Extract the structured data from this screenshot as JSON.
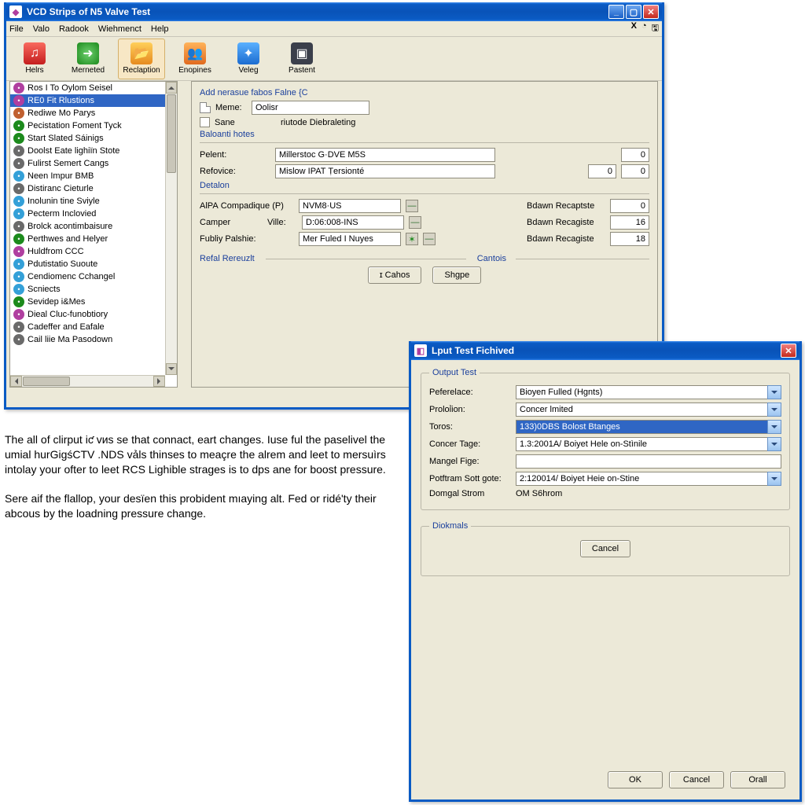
{
  "main_window": {
    "title": "VCD Strips of N5 Valve Test",
    "menu": [
      "File",
      "Valo",
      "Radook",
      "Wiehmenct",
      "Help"
    ],
    "toolbar": [
      {
        "icon": "ico-red",
        "label": "Helrs"
      },
      {
        "icon": "ico-green",
        "label": "Merneted"
      },
      {
        "icon": "ico-orange",
        "label": "Reclaption",
        "selected": true
      },
      {
        "icon": "ico-org2",
        "label": "Enopines"
      },
      {
        "icon": "ico-blue",
        "label": "Veleg"
      },
      {
        "icon": "ico-dark",
        "label": "Pastent"
      }
    ]
  },
  "sidebar": {
    "items": [
      {
        "ico": "#b03fa0",
        "label": "Ros I To Oylom Seisel"
      },
      {
        "ico": "#b03fa0",
        "label": "RE0 Fit Rlustions",
        "selected": true
      },
      {
        "ico": "#c06030",
        "label": "Rediwe Mo Parys"
      },
      {
        "ico": "#1c8a1c",
        "label": "Pecistation Foment Tyck"
      },
      {
        "ico": "#1c8a1c",
        "label": "Start Slated Sáinigs"
      },
      {
        "ico": "#6a6a6a",
        "label": "Doolst Eate lighiïn Stote"
      },
      {
        "ico": "#6a6a6a",
        "label": "Fulirst Semert Cangs"
      },
      {
        "ico": "#34a0d8",
        "label": "Neen Impur BMB"
      },
      {
        "ico": "#6a6a6a",
        "label": "Distiranc Cieturle"
      },
      {
        "ico": "#34a0d8",
        "label": "Inolunin tine Sviyle"
      },
      {
        "ico": "#34a0d8",
        "label": "Pecterm Inclovied"
      },
      {
        "ico": "#6a6a6a",
        "label": "Brolck acontimbaisure"
      },
      {
        "ico": "#1c8a1c",
        "label": "Perthwes and Helyer"
      },
      {
        "ico": "#b03fa0",
        "label": "Huldfrom CCC"
      },
      {
        "ico": "#34a0d8",
        "label": "Pdutistatio Suoute"
      },
      {
        "ico": "#34a0d8",
        "label": "Cendiomenc Cchangel"
      },
      {
        "ico": "#34a0d8",
        "label": "Scniects"
      },
      {
        "ico": "#1c8a1c",
        "label": "Sevidep i&Mes"
      },
      {
        "ico": "#b03fa0",
        "label": "Dieal Cluc-funobtiory"
      },
      {
        "ico": "#6a6a6a",
        "label": "Cadeffer and Eafale"
      },
      {
        "ico": "#6a6a6a",
        "label": "Cail liie Ma Pasodown"
      }
    ]
  },
  "form": {
    "heading1": "Add nerasue fabos Falne {C",
    "meme_lbl": "Meme:",
    "meme_val": "Oolisr",
    "sane_lbl": "Sane",
    "sane_val": "riutode Diebraleting",
    "sec2": "Baloanti hotes",
    "pelent_lbl": "Pelent:",
    "pelent_val": "Millerstoc G·DVE M5S",
    "pelent_num": "0",
    "refovice_lbl": "Refovice:",
    "refovice_val": "Mislow IPAT Ṭersionté",
    "refovice_num1": "0",
    "refovice_num2": "0",
    "sec3": "Detalon",
    "alpa_lbl": "AlРА Compadique (P)",
    "alpa_val": "NVM8·US",
    "bd1_lbl": "Bdawn Recaptste",
    "bd1_val": "0",
    "camper_lbl": "Camper",
    "ville_lbl": "Ville:",
    "ville_val": "D:06:008-INS",
    "bd2_lbl": "Bdawn Recagistе",
    "bd2_val": "16",
    "fubly_lbl": "Fubliy Palshie:",
    "fubly_val": "Mer Fuled I Nuyes",
    "bd3_lbl": "Bdawn Recagistе",
    "bd3_val": "18",
    "sec4a": "Refal Rereuzlt",
    "sec4b": "Cantois",
    "btn_cahos": "ɪ Cahos",
    "btn_shgpe": "Shgpe"
  },
  "dialog": {
    "title": "Lput Test Fichived",
    "group1": "Output Test",
    "rows": [
      {
        "label": "Peferelace:",
        "value": "Віоуеп Fulled (Hgnts)"
      },
      {
        "label": "Proloỉion:",
        "value": "Concer lmited"
      },
      {
        "label": "Toros:",
        "value": "133)0DBS Bolost Btanges",
        "selected": true
      },
      {
        "label": "Concer Tage:",
        "value": "1.3:2001A/ Boiyet Hele on-Stìnіle"
      },
      {
        "label": "Mangel Fige:",
        "value": ""
      },
      {
        "label": "Potftram Sott gote:",
        "value": "2:120014/ Boiyet Heie on-Stine"
      }
    ],
    "domgal_lbl": "Domgal Strom",
    "domgal_val": "ОM S6hrom",
    "group2": "Diokmals",
    "btn_cancel": "Cancel",
    "buttons": [
      "OK",
      "Cancel",
      "Orall"
    ]
  },
  "body_text": {
    "p1": "The all of clirput iƈ vᴎs se that connact, eart changes. Iuse ful the paselivel the umial hurGigśCTV .NDS vảls thinses to meaçre the alrem and leet to mersuìrs intolay your ofter to leet RCS Lighible strages is to dps ane for boost pressure.",
    "p2": "Sere aif the flallop, your desïen this probident mıaying alt. Fеd or ridé'ty their abcous by the loadning pressure change."
  }
}
